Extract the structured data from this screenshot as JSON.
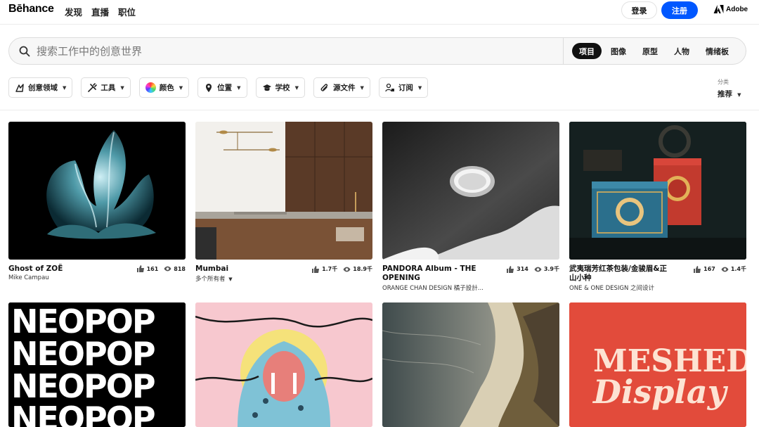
{
  "brand": {
    "logo": "Bēhance",
    "accent": "#0057ff"
  },
  "nav": {
    "links": [
      "发现",
      "直播",
      "职位"
    ],
    "login": "登录",
    "signup": "注册",
    "adobe": "Adobe"
  },
  "search": {
    "placeholder": "搜索工作中的创意世界",
    "tabs": [
      {
        "label": "项目",
        "active": true
      },
      {
        "label": "图像",
        "active": false
      },
      {
        "label": "原型",
        "active": false
      },
      {
        "label": "人物",
        "active": false
      },
      {
        "label": "情绪板",
        "active": false
      }
    ]
  },
  "filters": [
    "创意领域",
    "工具",
    "颜色",
    "位置",
    "学校",
    "源文件",
    "订阅"
  ],
  "sort": {
    "label": "分类",
    "value": "推荐"
  },
  "projects": [
    {
      "title": "Ghost of ZOË",
      "owner": "Mike Campau",
      "likes": "161",
      "views": "818"
    },
    {
      "title": "Mumbai",
      "owner": "多个所有者",
      "likes": "1.7千",
      "views": "18.9千"
    },
    {
      "title_line1": "PANDORA Album - THE",
      "title_line2": "OPENING",
      "owner": "ORANGE CHAN DESIGN 橘子設計...",
      "likes": "314",
      "views": "3.9千"
    },
    {
      "title_line1": "武夷瑞芳红茶包装/金骏眉&正",
      "title_line2": "山小种",
      "owner": "ONE & ONE DESIGN 之间设计",
      "likes": "167",
      "views": "1.4千"
    }
  ],
  "second_row": {
    "neopop": [
      "NEOPOP",
      "NEOPOP",
      "NEOPOP",
      "NEOPOP"
    ],
    "meshed_line1": "MESHED",
    "meshed_line2": "Display"
  }
}
